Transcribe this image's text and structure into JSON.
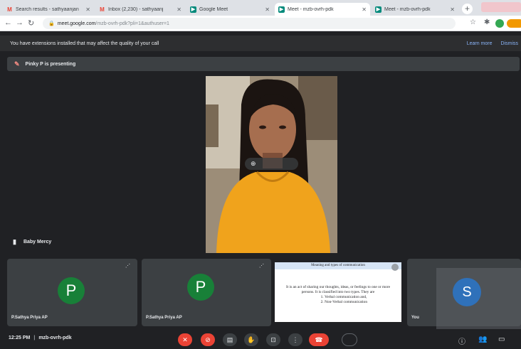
{
  "tabs": [
    {
      "label": "Search results - sathyaanjan",
      "icon": "M",
      "color": "#ea4335"
    },
    {
      "label": "Inbox (2,230) - sathyaanj",
      "icon": "M",
      "color": "#ea4335"
    },
    {
      "label": "Google Meet",
      "icon": "▶",
      "color": "#00897b"
    },
    {
      "label": "Meet - mzb-ovrh-pdk",
      "icon": "▶",
      "color": "#00897b"
    },
    {
      "label": "Meet - mzb-ovrh-pdk",
      "icon": "▶",
      "color": "#00897b"
    }
  ],
  "address": {
    "host": "meet.google.com",
    "path": "/mzb-ovrh-pdk?pli=1&authuser=1"
  },
  "warning": {
    "text": "You have extensions installed that may affect the quality of your call",
    "learn_more": "Learn more",
    "dismiss": "Dismiss"
  },
  "presenting": {
    "text": "Pinky P is presenting"
  },
  "speaker": {
    "name": "Baby Mercy"
  },
  "participants": [
    {
      "initial": "P",
      "name": "P.Sathya Priya AP",
      "color": "#188038"
    },
    {
      "initial": "P",
      "name": "P.Sathya Priya AP",
      "color": "#188038"
    }
  ],
  "slide": {
    "title": "Meaning and types of communication",
    "body": "It is an act of sharing our thoughts, ideas, or feelings to one or more persons. It is classified into two types. They are",
    "items": [
      "Verbal communication and,",
      "Non-Verbal communication"
    ]
  },
  "partial_tile": {
    "initial": "S",
    "name": "You",
    "color": "#2f71ba"
  },
  "bottom": {
    "time": "12:25 PM",
    "separator": "|",
    "code": "mzb-ovrh-pdk"
  }
}
